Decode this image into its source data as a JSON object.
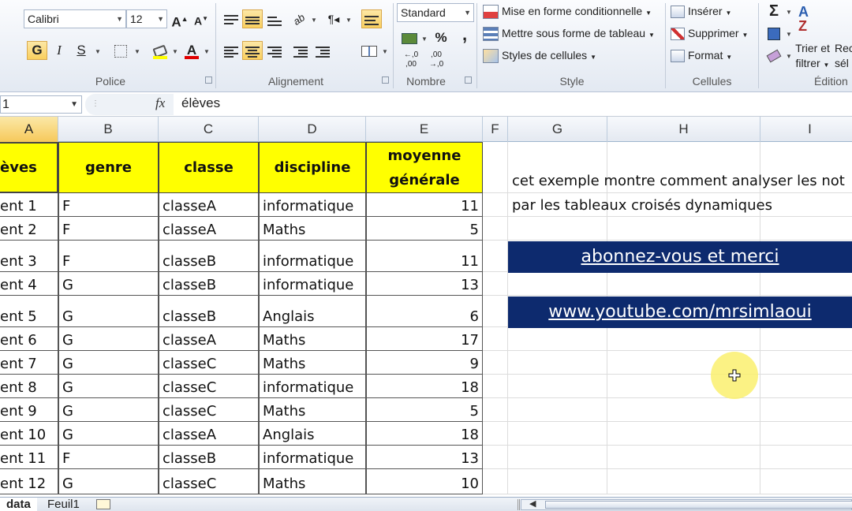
{
  "ribbon": {
    "font_name": "Calibri",
    "font_size": "12",
    "bold": "G",
    "italic": "I",
    "underline": "S",
    "grow_font": "A",
    "shrink_font": "A",
    "font_color": "A",
    "number_format": "Standard",
    "percent": "%",
    "thousands": ",",
    "dec_inc": "←,0 ,00",
    "dec_dec": ",00 →,0",
    "cond_format": "Mise en forme conditionnelle",
    "format_table": "Mettre sous forme de tableau",
    "cell_styles": "Styles de cellules",
    "insert": "Insérer",
    "delete": "Supprimer",
    "format": "Format",
    "sigma": "Σ",
    "sort_filter_1": "Trier et",
    "sort_filter_2": "filtrer",
    "find_select_1": "Rec",
    "find_select_2": "sél",
    "groups": {
      "police": "Police",
      "alignement": "Alignement",
      "nombre": "Nombre",
      "style": "Style",
      "cellules": "Cellules",
      "edition": "Édition"
    }
  },
  "formula_bar": {
    "name_box": "1",
    "fx": "fx",
    "content": "élèves"
  },
  "columns": [
    "A",
    "B",
    "C",
    "D",
    "E",
    "F",
    "G",
    "H",
    "I"
  ],
  "headers": {
    "a": "èves",
    "b": "genre",
    "c": "classe",
    "d": "discipline",
    "e1": "moyenne",
    "e2": "générale"
  },
  "rows": [
    {
      "a": "ent 1",
      "b": "F",
      "c": "classeA",
      "d": "informatique",
      "e": "11"
    },
    {
      "a": "ent 2",
      "b": "F",
      "c": "classeA",
      "d": "Maths",
      "e": "5"
    },
    {
      "a": "ent 3",
      "b": "F",
      "c": "classeB",
      "d": "informatique",
      "e": "11"
    },
    {
      "a": "ent 4",
      "b": "G",
      "c": "classeB",
      "d": "informatique",
      "e": "13"
    },
    {
      "a": "ent 5",
      "b": "G",
      "c": "classeB",
      "d": "Anglais",
      "e": "6"
    },
    {
      "a": "ent 6",
      "b": "G",
      "c": "classeA",
      "d": "Maths",
      "e": "17"
    },
    {
      "a": "ent 7",
      "b": "G",
      "c": "classeC",
      "d": "Maths",
      "e": "9"
    },
    {
      "a": "ent 8",
      "b": "G",
      "c": "classeC",
      "d": "informatique",
      "e": "18"
    },
    {
      "a": "ent 9",
      "b": "G",
      "c": "classeC",
      "d": "Maths",
      "e": "5"
    },
    {
      "a": "ent 10",
      "b": "G",
      "c": "classeA",
      "d": "Anglais",
      "e": "18"
    },
    {
      "a": "ent 11",
      "b": "F",
      "c": "classeB",
      "d": "informatique",
      "e": "13"
    },
    {
      "a": "ent 12",
      "b": "G",
      "c": "classeC",
      "d": "Maths",
      "e": "10"
    }
  ],
  "notes": {
    "line1": "cet exemple montre comment analyser les not",
    "line2": "par les tableaux croisés dynamiques",
    "banner1": "abonnez-vous et merci",
    "banner2": "www.youtube.com/mrsimlaoui"
  },
  "sheets": {
    "active": "data",
    "other": "Feuil1"
  },
  "colors": {
    "header_fill": "#ffff00",
    "banner_fill": "#0d2a6e",
    "banner_text": "#ffffff"
  }
}
